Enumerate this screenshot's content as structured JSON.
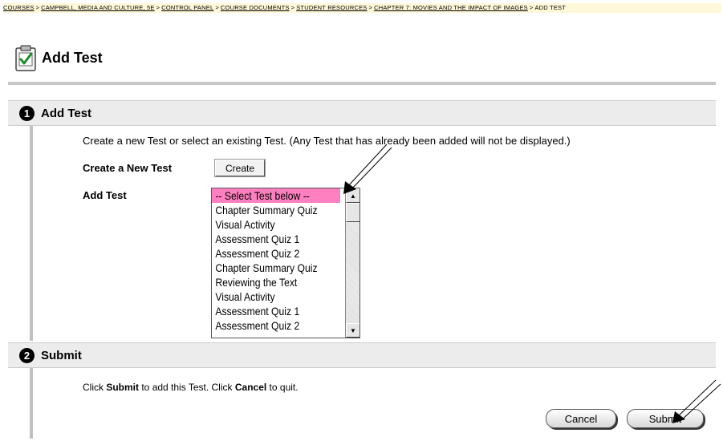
{
  "breadcrumb": {
    "items": [
      "COURSES",
      "CAMPBELL, MEDIA AND CULTURE, 5E",
      "CONTROL PANEL",
      "COURSE DOCUMENTS",
      "STUDENT RESOURCES",
      "CHAPTER 7: MOVIES AND THE IMPACT OF IMAGES"
    ],
    "separator": ">",
    "current": "ADD TEST"
  },
  "page": {
    "title": "Add Test",
    "icon": "checklist-icon"
  },
  "section1": {
    "number": "1",
    "title": "Add Test",
    "instructions": "Create a new Test or select an existing Test. (Any Test that has already been added will not be displayed.)",
    "create_label": "Create a New Test",
    "create_button": "Create",
    "add_label": "Add Test",
    "options": [
      "-- Select Test below --",
      "Chapter Summary Quiz",
      "Visual Activity",
      "Assessment Quiz 1",
      "Assessment Quiz 2",
      "Chapter Summary Quiz",
      "Reviewing the Text",
      "Visual Activity",
      "Assessment Quiz 1",
      "Assessment Quiz 2"
    ],
    "selected": "-- Select Test below --"
  },
  "section2": {
    "number": "2",
    "title": "Submit",
    "text_pre": "Click ",
    "text_submit": "Submit",
    "text_mid": " to add this Test. Click ",
    "text_cancel": "Cancel",
    "text_post": " to quit.",
    "cancel_button": "Cancel",
    "submit_button": "Submit"
  },
  "colors": {
    "breadcrumb_bg": "#fff8d8",
    "section_bg": "#ececec",
    "selected_option": "#ff80c0"
  }
}
